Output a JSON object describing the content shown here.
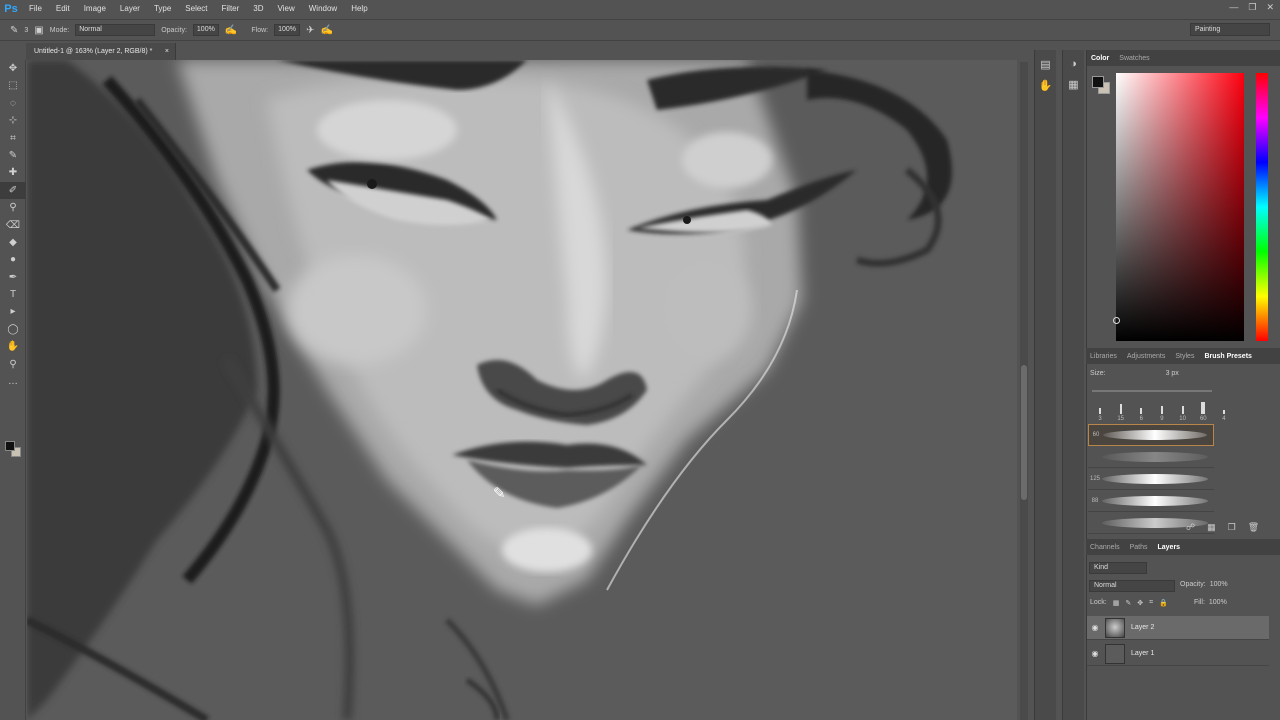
{
  "app": {
    "logo": "Ps"
  },
  "menu": [
    "File",
    "Edit",
    "Image",
    "Layer",
    "Type",
    "Select",
    "Filter",
    "3D",
    "View",
    "Window",
    "Help"
  ],
  "window_controls": [
    "—",
    "❐",
    "✕"
  ],
  "options": {
    "mode_label": "Mode:",
    "mode_value": "Normal",
    "opacity_label": "Opacity:",
    "opacity_value": "100%",
    "flow_label": "Flow:",
    "flow_value": "100%",
    "brush_size": "3",
    "workspace": "Painting"
  },
  "document": {
    "tab_title": "Untitled-1 @ 163% (Layer 2, RGB/8) *",
    "close": "×"
  },
  "tools": [
    "✥",
    "⬚",
    "◌",
    "⊹",
    "⌗",
    "✎",
    "✚",
    "✐",
    "⚲",
    "⌫",
    "◆",
    "●",
    "✒",
    "T",
    "▸",
    "◯",
    "✋",
    "⚲",
    "…"
  ],
  "color_panel": {
    "tabs": [
      "Color",
      "Swatches"
    ],
    "active_tab": "Color"
  },
  "brush_panel": {
    "tabs": [
      "Libraries",
      "Adjustments",
      "Styles",
      "Brush Presets"
    ],
    "active_tab": "Brush Presets",
    "size_label": "Size:",
    "size_value": "3 px",
    "tips": [
      "3",
      "15",
      "6",
      "9",
      "10",
      "60",
      "4"
    ],
    "presets": [
      {
        "num": "60"
      },
      {
        "num": ""
      },
      {
        "num": "125"
      },
      {
        "num": "88"
      },
      {
        "num": ""
      }
    ]
  },
  "layers_panel": {
    "tabs": [
      "Channels",
      "Paths",
      "Layers"
    ],
    "active_tab": "Layers",
    "filter_label": "Kind",
    "blend_mode": "Normal",
    "opacity_label": "Opacity:",
    "opacity_value": "100%",
    "lock_label": "Lock:",
    "fill_label": "Fill:",
    "fill_value": "100%",
    "layers": [
      {
        "name": "Layer 2",
        "selected": true
      },
      {
        "name": "Layer 1",
        "selected": false
      }
    ]
  },
  "colors": {
    "foreground": "#111111",
    "background": "#c9c1b3",
    "accent": "#31a8ff"
  }
}
